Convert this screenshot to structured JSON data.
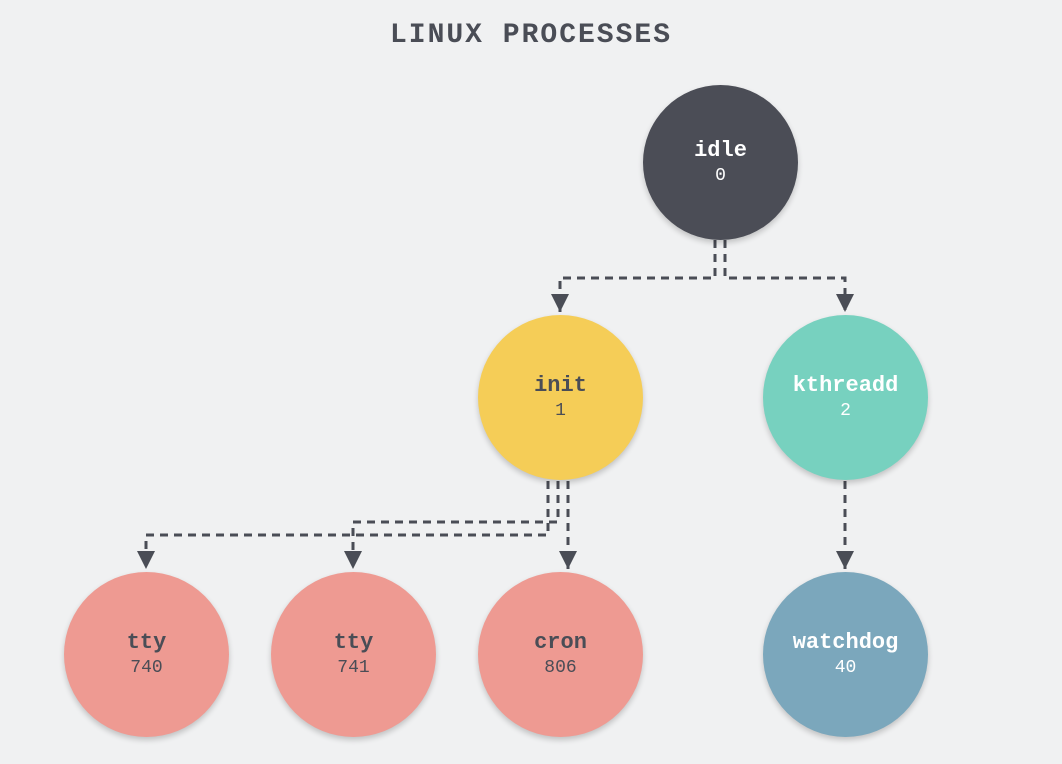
{
  "title": "LINUX PROCESSES",
  "nodes": {
    "idle": {
      "name": "idle",
      "pid": "0"
    },
    "init": {
      "name": "init",
      "pid": "1"
    },
    "kthreadd": {
      "name": "kthreadd",
      "pid": "2"
    },
    "tty1": {
      "name": "tty",
      "pid": "740"
    },
    "tty2": {
      "name": "tty",
      "pid": "741"
    },
    "cron": {
      "name": "cron",
      "pid": "806"
    },
    "watchdog": {
      "name": "watchdog",
      "pid": "40"
    }
  },
  "edges": [
    {
      "from": "idle",
      "to": "init"
    },
    {
      "from": "idle",
      "to": "kthreadd"
    },
    {
      "from": "init",
      "to": "tty1"
    },
    {
      "from": "init",
      "to": "tty2"
    },
    {
      "from": "init",
      "to": "cron"
    },
    {
      "from": "kthreadd",
      "to": "watchdog"
    }
  ],
  "colors": {
    "edgeStroke": "#4a4d56"
  }
}
